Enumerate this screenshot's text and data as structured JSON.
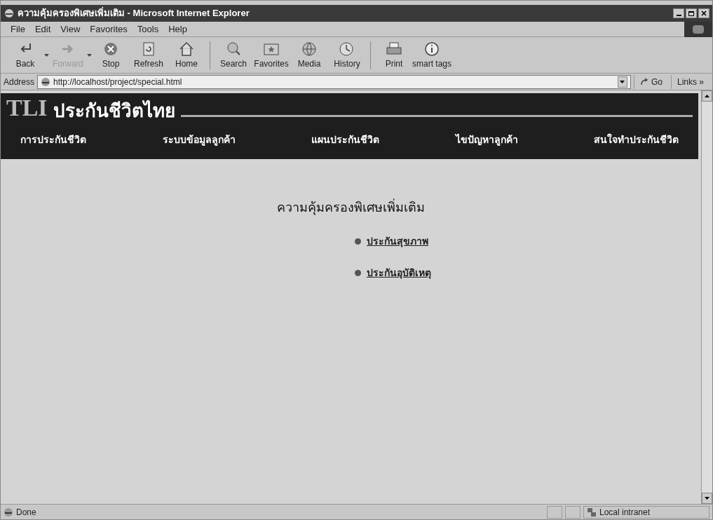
{
  "window": {
    "title": "ความคุ้มครองพิเศษเพิ่มเติม - Microsoft Internet Explorer"
  },
  "menu": [
    "File",
    "Edit",
    "View",
    "Favorites",
    "Tools",
    "Help"
  ],
  "toolbar": [
    [
      {
        "label": "Back",
        "disabled": false,
        "dropdown": true
      },
      {
        "label": "Forward",
        "disabled": true,
        "dropdown": true
      },
      {
        "label": "Stop",
        "disabled": false,
        "dropdown": false
      },
      {
        "label": "Refresh",
        "disabled": false,
        "dropdown": false
      },
      {
        "label": "Home",
        "disabled": false,
        "dropdown": false
      }
    ],
    [
      {
        "label": "Search",
        "disabled": false,
        "dropdown": false
      },
      {
        "label": "Favorites",
        "disabled": false,
        "dropdown": false
      },
      {
        "label": "Media",
        "disabled": false,
        "dropdown": false
      },
      {
        "label": "History",
        "disabled": false,
        "dropdown": false
      }
    ],
    [
      {
        "label": "Print",
        "disabled": false,
        "dropdown": false
      },
      {
        "label": "smart tags",
        "disabled": false,
        "dropdown": false
      }
    ]
  ],
  "address_bar": {
    "label": "Address",
    "value": "http://localhost/project/special.html",
    "go": "Go",
    "links": "Links",
    "links_more": "»"
  },
  "page": {
    "logo_letters": "TLI",
    "logo_text": "ประกันชีวิตไทย",
    "nav": [
      "การประกันชีวิต",
      "ระบบข้อมูลลูกค้า",
      "แผนประกันชีวิต",
      "ไขปัญหาลูกค้า",
      "สนใจทำประกันชีวิต"
    ],
    "heading": "ความคุ้มครองพิเศษเพิ่มเติม",
    "links": [
      "ประกันสุขภาพ",
      "ประกันอุบัติเหตุ"
    ]
  },
  "status_bar": {
    "text": "Done",
    "zone": "Local intranet"
  }
}
